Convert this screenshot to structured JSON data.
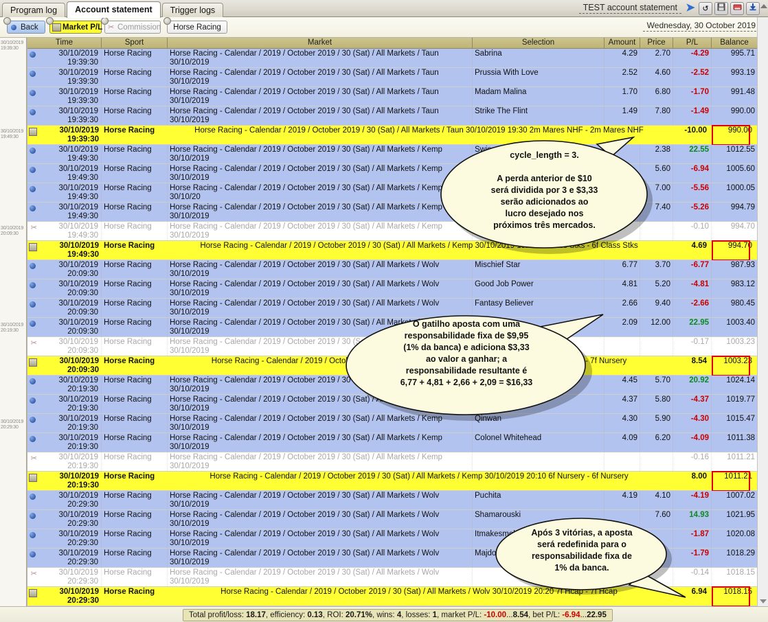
{
  "titlebar": {
    "tabs": [
      {
        "label": "Program log",
        "active": false
      },
      {
        "label": "Account statement",
        "active": true
      },
      {
        "label": "Trigger logs",
        "active": false
      }
    ],
    "window_title": "TEST account statement",
    "arrow_icon": "chevron-right-icon",
    "buttons": [
      {
        "name": "refresh-button",
        "glyph": "↻"
      },
      {
        "name": "save-button",
        "glyph": "💾"
      },
      {
        "name": "export-button",
        "glyph": "▬"
      },
      {
        "name": "download-button",
        "glyph": "⬇"
      }
    ]
  },
  "toolbar": {
    "back_label": "Back",
    "market_pl_label": "Market P/L",
    "commission_label": "Commission",
    "sport_label": "Horse Racing",
    "date_label": "Wednesday, 30 October 2019"
  },
  "grid": {
    "columns": [
      "Time",
      "Sport",
      "Market",
      "Selection",
      "Amount",
      "Price",
      "P/L",
      "Balance"
    ],
    "gutter_stamps": [
      "30/10/2019\n19:39:30",
      "30/10/2019\n19:49:30",
      "30/10/2019\n20:09:30",
      "30/10/2019\n20:19:30",
      "30/10/2019\n20:29:30"
    ],
    "rows": [
      {
        "icon": "bullet-icon",
        "kind": "blue",
        "date": "30/10/2019",
        "time": "19:39:30",
        "sport": "Horse Racing",
        "market1": "Horse Racing - Calendar / 2019 / October 2019 / 30 (Sat) / All Markets / Taun 30/10/2019",
        "market2": "19:30 2m Mares NHF - 2m Mares NHF",
        "selection": "Sabrina",
        "amount": "4.29",
        "price": "2.70",
        "pl": "-4.29",
        "pl_sign": "neg",
        "balance": "995.71",
        "boxed": false
      },
      {
        "icon": "bullet-icon",
        "kind": "blue",
        "date": "30/10/2019",
        "time": "19:39:30",
        "sport": "Horse Racing",
        "market1": "Horse Racing - Calendar / 2019 / October 2019 / 30 (Sat) / All Markets / Taun 30/10/2019",
        "market2": "19:30 2m Mares NHF - 2m Mares NHF",
        "selection": "Prussia With Love",
        "amount": "2.52",
        "price": "4.60",
        "pl": "-2.52",
        "pl_sign": "neg",
        "balance": "993.19",
        "boxed": false
      },
      {
        "icon": "bullet-icon",
        "kind": "blue",
        "date": "30/10/2019",
        "time": "19:39:30",
        "sport": "Horse Racing",
        "market1": "Horse Racing - Calendar / 2019 / October 2019 / 30 (Sat) / All Markets / Taun 30/10/2019",
        "market2": "19:30 2m Mares NHF - 2m Mares NHF",
        "selection": "Madam Malina",
        "amount": "1.70",
        "price": "6.80",
        "pl": "-1.70",
        "pl_sign": "neg",
        "balance": "991.48",
        "boxed": false
      },
      {
        "icon": "bullet-icon",
        "kind": "blue",
        "date": "30/10/2019",
        "time": "19:39:30",
        "sport": "Horse Racing",
        "market1": "Horse Racing - Calendar / 2019 / October 2019 / 30 (Sat) / All Markets / Taun 30/10/2019",
        "market2": "19:30 2m Mares NHF - 2m Mares NHF",
        "selection": "Strike The Flint",
        "amount": "1.49",
        "price": "7.80",
        "pl": "-1.49",
        "pl_sign": "neg",
        "balance": "990.00",
        "boxed": false
      },
      {
        "icon": "sheet-icon",
        "kind": "yellow",
        "date": "30/10/2019",
        "time": "19:39:30",
        "sport": "Horse Racing",
        "market1": "Horse Racing - Calendar / 2019 / October 2019 / 30 (Sat) / All Markets / Taun 30/10/2019 19:30 2m Mares NHF - 2m Mares NHF",
        "market2": "",
        "selection": "",
        "amount": "",
        "price": "",
        "pl": "-10.00",
        "pl_sign": "neg",
        "balance": "990.00",
        "boxed": true
      },
      {
        "icon": "bullet-icon",
        "kind": "blue",
        "date": "30/10/2019",
        "time": "19:49:30",
        "sport": "Horse Racing",
        "market1": "Horse Racing - Calendar / 2019 / October 2019 / 30 (Sat) / All Markets / Kemp 30/10/2019",
        "market2": "19:40 6f Class Stks - 6f Class Stks",
        "selection": "Swiss Cross",
        "amount": "",
        "price": "2.38",
        "pl": "22.55",
        "pl_sign": "pos",
        "balance": "1012.55",
        "boxed": false
      },
      {
        "icon": "bullet-icon",
        "kind": "blue",
        "date": "30/10/2019",
        "time": "19:49:30",
        "sport": "Horse Racing",
        "market1": "Horse Racing - Calendar / 2019 / October 2019 / 30 (Sat) / All Markets / Kemp 30/10/2019",
        "market2": "19:40 6f Class Stks - 6f Class Stks",
        "selection": "",
        "amount": "",
        "price": "5.60",
        "pl": "-6.94",
        "pl_sign": "neg",
        "balance": "1005.60",
        "boxed": false
      },
      {
        "icon": "bullet-icon",
        "kind": "blue",
        "date": "30/10/2019",
        "time": "19:49:30",
        "sport": "Horse Racing",
        "market1": "Horse Racing - Calendar / 2019 / October 2019 / 30 (Sat) / All Markets / Kemp 30/10/20",
        "market2": "19:40 6f Class Stks - 6f Class Stks",
        "selection": "",
        "amount": "",
        "price": "7.00",
        "pl": "-5.56",
        "pl_sign": "neg",
        "balance": "1000.05",
        "boxed": false
      },
      {
        "icon": "bullet-icon",
        "kind": "blue",
        "date": "30/10/2019",
        "time": "19:49:30",
        "sport": "Horse Racing",
        "market1": "Horse Racing - Calendar / 2019 / October 2019 / 30 (Sat) / All Markets / Kemp 30/10/2019",
        "market2": "19:40 6f Class Stks - 6f Class Stks",
        "selection": "",
        "amount": "",
        "price": "7.40",
        "pl": "-5.26",
        "pl_sign": "neg",
        "balance": "994.79",
        "boxed": false
      },
      {
        "icon": "scissors-icon",
        "kind": "white",
        "date": "30/10/2019",
        "time": "19:49:30",
        "sport": "Horse Racing",
        "market1": "Horse Racing - Calendar / 2019 / October 2019 / 30 (Sat) / All Markets / Kemp 30/10/2019",
        "market2": "19:40 6f Class Stks - 6f Class Stks",
        "selection": "",
        "amount": "",
        "price": "",
        "pl": "-0.10",
        "pl_sign": "neg",
        "balance": "994.70",
        "boxed": false
      },
      {
        "icon": "sheet-icon",
        "kind": "yellow",
        "date": "30/10/2019",
        "time": "19:49:30",
        "sport": "Horse Racing",
        "market1": "Horse Racing - Calendar / 2019 / October 2019 / 30 (Sat) / All Markets / Kemp 30/10/2019 19:40 6f Class Stks - 6f Class Stks",
        "market2": "",
        "selection": "",
        "amount": "",
        "price": "",
        "pl": "4.69",
        "pl_sign": "pos",
        "balance": "994.70",
        "boxed": true
      },
      {
        "icon": "bullet-icon",
        "kind": "blue",
        "date": "30/10/2019",
        "time": "20:09:30",
        "sport": "Horse Racing",
        "market1": "Horse Racing - Calendar / 2019 / October 2019 / 30 (Sat) / All Markets / Wolv 30/10/2019",
        "market2": "19:50 7f Nursery - 7f Nursery",
        "selection": "Mischief Star",
        "amount": "6.77",
        "price": "3.70",
        "pl": "-6.77",
        "pl_sign": "neg",
        "balance": "987.93",
        "boxed": false
      },
      {
        "icon": "bullet-icon",
        "kind": "blue",
        "date": "30/10/2019",
        "time": "20:09:30",
        "sport": "Horse Racing",
        "market1": "Horse Racing - Calendar / 2019 / October 2019 / 30 (Sat) / All Markets / Wolv 30/10/2019",
        "market2": "19:50 7f Nursery - 7f Nursery",
        "selection": "Good Job Power",
        "amount": "4.81",
        "price": "5.20",
        "pl": "-4.81",
        "pl_sign": "neg",
        "balance": "983.12",
        "boxed": false
      },
      {
        "icon": "bullet-icon",
        "kind": "blue",
        "date": "30/10/2019",
        "time": "20:09:30",
        "sport": "Horse Racing",
        "market1": "Horse Racing - Calendar / 2019 / October 2019 / 30 (Sat) / All Markets / Wolv 30/10/2019",
        "market2": "19:50 7f Nursery - 7f Nursery",
        "selection": "Fantasy Believer",
        "amount": "2.66",
        "price": "9.40",
        "pl": "-2.66",
        "pl_sign": "neg",
        "balance": "980.45",
        "boxed": false
      },
      {
        "icon": "bullet-icon",
        "kind": "blue",
        "date": "30/10/2019",
        "time": "20:09:30",
        "sport": "Horse Racing",
        "market1": "Horse Racing - Calendar / 2019 / October 2019 / 30 (Sat) / All Markets / Wolv 30/10/2019",
        "market2": "19:50 7f Nursery - 7f Nursery",
        "selection": "",
        "amount": "2.09",
        "price": "12.00",
        "pl": "22.95",
        "pl_sign": "pos",
        "balance": "1003.40",
        "boxed": false
      },
      {
        "icon": "scissors-icon",
        "kind": "white",
        "date": "30/10/2019",
        "time": "20:09:30",
        "sport": "Horse Racing",
        "market1": "Horse Racing - Calendar / 2019 / October 2019 / 30 (Sat) / All Markets / Wolv 30/10/2019",
        "market2": "19:50 7f Nursery - 7f Nursery",
        "selection": "",
        "amount": "",
        "price": "",
        "pl": "-0.17",
        "pl_sign": "neg",
        "balance": "1003.23",
        "boxed": false
      },
      {
        "icon": "sheet-icon",
        "kind": "yellow",
        "date": "30/10/2019",
        "time": "20:09:30",
        "sport": "Horse Racing",
        "market1": "Horse Racing - Calendar / 2019 / October 2019 / 30 (Sat) / All Markets / Wolv 30/10/2019 19:50 7f Nursery - 7f Nursery",
        "market2": "",
        "selection": "",
        "amount": "",
        "price": "",
        "pl": "8.54",
        "pl_sign": "pos",
        "balance": "1003.23",
        "boxed": true
      },
      {
        "icon": "bullet-icon",
        "kind": "blue",
        "date": "30/10/2019",
        "time": "20:19:30",
        "sport": "Horse Racing",
        "market1": "Horse Racing - Calendar / 2019 / October 2019 / 30 (Sat) / All Markets / Kemp 30/10/2019",
        "market2": "20:10 6f Nursery - 6f Nursery",
        "selection": "",
        "amount": "4.45",
        "price": "5.70",
        "pl": "20.92",
        "pl_sign": "pos",
        "balance": "1024.14",
        "boxed": false
      },
      {
        "icon": "bullet-icon",
        "kind": "blue",
        "date": "30/10/2019",
        "time": "20:19:30",
        "sport": "Horse Racing",
        "market1": "Horse Racing - Calendar / 2019 / October 2019 / 30 (Sat) / All Markets / Kemp 30/10/2019",
        "market2": "20:10 6f Nursery - 6f Nursery",
        "selection": "",
        "amount": "4.37",
        "price": "5.80",
        "pl": "-4.37",
        "pl_sign": "neg",
        "balance": "1019.77",
        "boxed": false
      },
      {
        "icon": "bullet-icon",
        "kind": "blue",
        "date": "30/10/2019",
        "time": "20:19:30",
        "sport": "Horse Racing",
        "market1": "Horse Racing - Calendar / 2019 / October 2019 / 30 (Sat) / All Markets / Kemp 30/10/2019",
        "market2": "20:10 6f Nursery - 6f Nursery",
        "selection": "Qinwan",
        "amount": "4.30",
        "price": "5.90",
        "pl": "-4.30",
        "pl_sign": "neg",
        "balance": "1015.47",
        "boxed": false
      },
      {
        "icon": "bullet-icon",
        "kind": "blue",
        "date": "30/10/2019",
        "time": "20:19:30",
        "sport": "Horse Racing",
        "market1": "Horse Racing - Calendar / 2019 / October 2019 / 30 (Sat) / All Markets / Kemp 30/10/2019",
        "market2": "20:10 6f Nursery - 6f Nursery",
        "selection": "Colonel Whitehead",
        "amount": "4.09",
        "price": "6.20",
        "pl": "-4.09",
        "pl_sign": "neg",
        "balance": "1011.38",
        "boxed": false
      },
      {
        "icon": "scissors-icon",
        "kind": "white",
        "date": "30/10/2019",
        "time": "20:19:30",
        "sport": "Horse Racing",
        "market1": "Horse Racing - Calendar / 2019 / October 2019 / 30 (Sat) / All Markets / Kemp 30/10/2019",
        "market2": "20:10 6f Nursery - 6f Nursery",
        "selection": "",
        "amount": "",
        "price": "",
        "pl": "-0.16",
        "pl_sign": "neg",
        "balance": "1011.21",
        "boxed": false
      },
      {
        "icon": "sheet-icon",
        "kind": "yellow",
        "date": "30/10/2019",
        "time": "20:19:30",
        "sport": "Horse Racing",
        "market1": "Horse Racing - Calendar / 2019 / October 2019 / 30 (Sat) / All Markets / Kemp 30/10/2019 20:10 6f Nursery - 6f Nursery",
        "market2": "",
        "selection": "",
        "amount": "",
        "price": "",
        "pl": "8.00",
        "pl_sign": "pos",
        "balance": "1011.21",
        "boxed": true
      },
      {
        "icon": "bullet-icon",
        "kind": "blue",
        "date": "30/10/2019",
        "time": "20:29:30",
        "sport": "Horse Racing",
        "market1": "Horse Racing - Calendar / 2019 / October 2019 / 30 (Sat) / All Markets / Wolv 30/10/2019",
        "market2": "20:20 7f Hcap - 7f Hcap",
        "selection": "Puchita",
        "amount": "4.19",
        "price": "4.10",
        "pl": "-4.19",
        "pl_sign": "neg",
        "balance": "1007.02",
        "boxed": false
      },
      {
        "icon": "bullet-icon",
        "kind": "blue",
        "date": "30/10/2019",
        "time": "20:29:30",
        "sport": "Horse Racing",
        "market1": "Horse Racing - Calendar / 2019 / October 2019 / 30 (Sat) / All Markets / Wolv 30/10/2019",
        "market2": "20:20 7f Hcap - 7f Hcap",
        "selection": "Shamarouski",
        "amount": "",
        "price": "7.60",
        "pl": "14.93",
        "pl_sign": "pos",
        "balance": "1021.95",
        "boxed": false
      },
      {
        "icon": "bullet-icon",
        "kind": "blue",
        "date": "30/10/2019",
        "time": "20:29:30",
        "sport": "Horse Racing",
        "market1": "Horse Racing - Calendar / 2019 / October 2019 / 30 (Sat) / All Markets / Wolv 30/10/2019",
        "market2": "20:20 7f Hcap - 7f Hcap",
        "selection": "Itmakesmelaugh",
        "amount": "",
        "price": "",
        "pl": "-1.87",
        "pl_sign": "neg",
        "balance": "1020.08",
        "boxed": false
      },
      {
        "icon": "bullet-icon",
        "kind": "blue",
        "date": "30/10/2019",
        "time": "20:29:30",
        "sport": "Horse Racing",
        "market1": "Horse Racing - Calendar / 2019 / October 2019 / 30 (Sat) / All Markets / Wolv 30/10/2019",
        "market2": "20:20 7f Hcap - 7f Hcap",
        "selection": "Majdool",
        "amount": "",
        "price": "",
        "pl": "-1.79",
        "pl_sign": "neg",
        "balance": "1018.29",
        "boxed": false
      },
      {
        "icon": "scissors-icon",
        "kind": "white",
        "date": "30/10/2019",
        "time": "20:29:30",
        "sport": "Horse Racing",
        "market1": "Horse Racing - Calendar / 2019 / October 2019 / 30 (Sat) / All Markets / Wolv 30/10/2019",
        "market2": "20:20 7f Hcap - 7f Hcap",
        "selection": "",
        "amount": "",
        "price": "",
        "pl": "-0.14",
        "pl_sign": "neg",
        "balance": "1018.15",
        "boxed": false
      },
      {
        "icon": "sheet-icon",
        "kind": "yellow",
        "date": "30/10/2019",
        "time": "20:29:30",
        "sport": "Horse Racing",
        "market1": "Horse Racing - Calendar / 2019 / October 2019 / 30 (Sat) / All Markets / Wolv 30/10/2019 20:20 7f Hcap - 7f Hcap",
        "market2": "",
        "selection": "",
        "amount": "",
        "price": "",
        "pl": "6.94",
        "pl_sign": "pos",
        "balance": "1018.15",
        "boxed": true
      }
    ]
  },
  "callouts": [
    {
      "name": "callout-cycle-length",
      "text": "cycle_length = 3.\n\nA perda anterior de $10\nserá dividida por 3 e $3,33\nserão adicionados ao\nlucro desejado nos\npróximos três mercados."
    },
    {
      "name": "callout-trigger-liability",
      "text": "O gatilho aposta com uma\nresponsabilidade fixa de $9,95\n(1% da banca) e adiciona $3,33\nao valor a ganhar; a\nresponsabilidade resultante é\n6,77 + 4,81 + 2,66 + 2,09 = $16,33"
    },
    {
      "name": "callout-reset-after-wins",
      "text": "Após 3 vitórias, a aposta\nserá redefinida para o\nresponsabilidade fixa de\n1% da banca."
    }
  ],
  "statusbar": {
    "prefix": "Total profit/loss: ",
    "total_profit_loss": "18.17",
    "efficiency_label": ", efficiency: ",
    "efficiency": "0.13",
    "roi_label": ", ROI: ",
    "roi": "20.71%",
    "wins_label": ", wins: ",
    "wins": "4",
    "losses_label": ", losses: ",
    "losses": "1",
    "market_pl_label": ", market P/L: ",
    "market_pl_min": "-10.00",
    "market_pl_sep": "...",
    "market_pl_max": "8.54",
    "bet_pl_label": ", bet P/L: ",
    "bet_pl_min": "-6.94",
    "bet_pl_sep": "...",
    "bet_pl_max": "22.95"
  },
  "colors": {
    "header_gold": "#bfb477",
    "row_blue": "#b3c3f0",
    "row_yellow": "#ffff33",
    "negative": "#cc0000",
    "positive": "#0b8a22",
    "box_red": "#e00000"
  }
}
